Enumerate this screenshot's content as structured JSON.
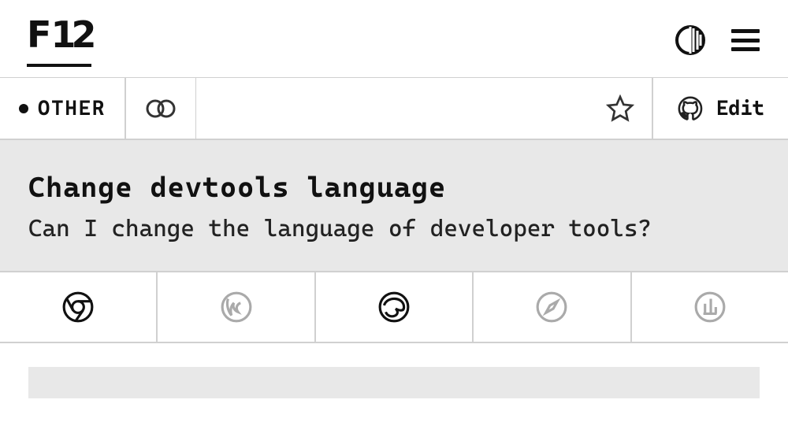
{
  "header": {
    "logo_prefix": "F",
    "logo_num": "12"
  },
  "tabs": {
    "category": "OTHER",
    "edit_label": "Edit"
  },
  "hero": {
    "title": "Change devtools language",
    "subtitle": "Can I change the language of developer tools?"
  },
  "browsers": [
    {
      "name": "chrome",
      "active": true
    },
    {
      "name": "firefox",
      "active": false
    },
    {
      "name": "edge",
      "active": true
    },
    {
      "name": "safari",
      "active": false
    },
    {
      "name": "polypane",
      "active": false
    }
  ]
}
